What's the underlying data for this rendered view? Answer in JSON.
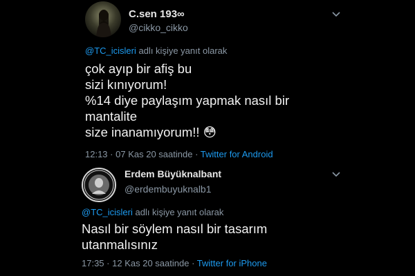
{
  "tweets": [
    {
      "display_name": "C.sen 193∞",
      "handle": "@cikko_cikko",
      "reply_mention": "@TC_icisleri",
      "reply_suffix": " adlı kişiye yanıt olarak",
      "body": "çok ayıp bir afiş bu\n sizi kınıyorum!\n%14 diye paylaşım yapmak nasıl bir mantalite\nsize inanamıyorum!! 😳",
      "time": "12:13",
      "date": "07 Kas 20",
      "suffix": "saatinde",
      "source": "Twitter for Android"
    },
    {
      "display_name": "Erdem Büyüknalbant",
      "handle": "@erdembuyuknalb1",
      "reply_mention": "@TC_icisleri",
      "reply_suffix": " adlı kişiye yanıt olarak",
      "body": "Nasıl bir söylem nasıl bir tasarım\nutanmalısınız",
      "time": "17:35",
      "date": "12 Kas 20",
      "suffix": "saatinde",
      "source": "Twitter for iPhone"
    }
  ],
  "colors": {
    "background": "#000000",
    "link": "#1d9bf0",
    "muted": "#8b98a5"
  },
  "icons": [
    "avatar-photo",
    "avatar-logo",
    "chevron-down-icon"
  ]
}
